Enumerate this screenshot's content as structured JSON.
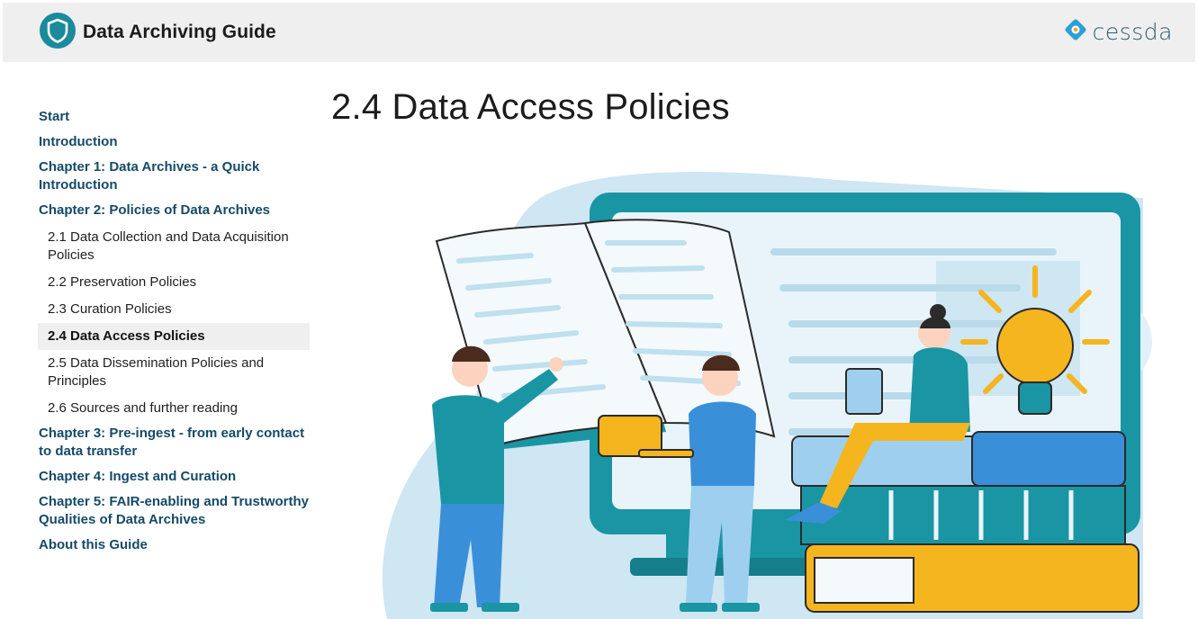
{
  "header": {
    "title": "Data Archiving Guide",
    "logo_icon": "shield-logo-icon",
    "partner_logo_text": "cessda",
    "partner_logo_icon": "cessda-diamond-icon"
  },
  "sidebar": {
    "items": [
      {
        "label": "Start",
        "level": "chapter"
      },
      {
        "label": "Introduction",
        "level": "chapter"
      },
      {
        "label": "Chapter 1: Data Archives - a Quick Introduction",
        "level": "chapter"
      },
      {
        "label": "Chapter 2: Policies of Data Archives",
        "level": "chapter"
      },
      {
        "label": "2.1 Data Collection and Data Acquisition Policies",
        "level": "sub"
      },
      {
        "label": "2.2 Preservation Policies",
        "level": "sub"
      },
      {
        "label": "2.3 Curation Policies",
        "level": "sub"
      },
      {
        "label": "2.4 Data Access Policies",
        "level": "sub",
        "active": true
      },
      {
        "label": "2.5 Data Dissemination Policies and Principles",
        "level": "sub"
      },
      {
        "label": "2.6 Sources and further reading",
        "level": "sub"
      },
      {
        "label": "Chapter 3: Pre-ingest - from early contact to data transfer",
        "level": "chapter"
      },
      {
        "label": "Chapter 4: Ingest and Curation",
        "level": "chapter"
      },
      {
        "label": "Chapter 5: FAIR-enabling and Trustworthy Qualities of Data Archives",
        "level": "chapter"
      },
      {
        "label": "About this Guide",
        "level": "chapter"
      }
    ]
  },
  "main": {
    "title": "2.4 Data Access Policies",
    "illustration": "people-reading-books-illustration"
  },
  "colors": {
    "brand_teal": "#1a8a9c",
    "nav_blue": "#154a67",
    "teal": "#1a95a3",
    "yellow": "#f5b51e",
    "blue": "#3a8fd9",
    "light_blue": "#cfe6f3"
  }
}
